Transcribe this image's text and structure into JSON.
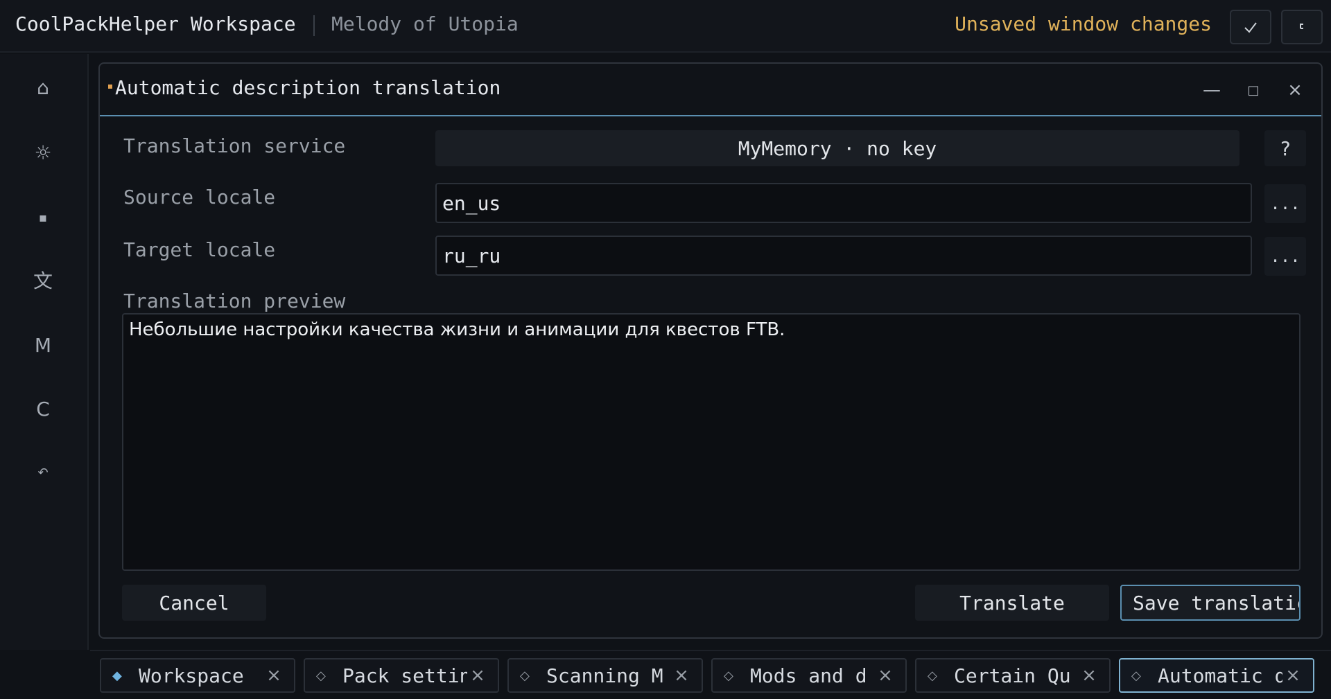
{
  "topbar": {
    "app_title": "CoolPackHelper Workspace",
    "project_name": "Melody of Utopia",
    "status": "Unsaved window changes",
    "status_color": "#e0b25a",
    "apply_icon": "check-icon",
    "revert_icon": "undo-icon"
  },
  "sidebar": {
    "items": [
      {
        "glyph": "⌂",
        "icon": "home-icon"
      },
      {
        "glyph": "☼",
        "icon": "settings-sun-icon"
      },
      {
        "glyph": "▪",
        "icon": "block-icon"
      },
      {
        "glyph": "文",
        "icon": "translate-icon"
      },
      {
        "glyph": "M",
        "icon": "mods-icon"
      },
      {
        "glyph": "C",
        "icon": "config-icon"
      },
      {
        "glyph": "↶",
        "icon": "back-icon"
      }
    ]
  },
  "window": {
    "title": "Automatic description translation",
    "fields": {
      "service_label": "Translation service",
      "service_value": "MyMemory · no key",
      "help_label": "?",
      "source_label": "Source locale",
      "source_value": "en_us",
      "target_label": "Target locale",
      "target_value": "ru_ru",
      "browse_label": "...",
      "preview_label": "Translation preview",
      "preview_text": "Небольшие настройки качества жизни и анимации для квестов FTB."
    },
    "buttons": {
      "cancel": "Cancel",
      "translate": "Translate",
      "save": "Save translatic"
    },
    "accent_color": "#5b8fb0"
  },
  "tabs": [
    {
      "label": "Workspace",
      "active": false
    },
    {
      "label": "Pack settin",
      "active": false
    },
    {
      "label": "Scanning M",
      "active": false
    },
    {
      "label": "Mods and d",
      "active": false
    },
    {
      "label": "Certain Qu",
      "active": false
    },
    {
      "label": "Automatic d",
      "active": true
    }
  ]
}
